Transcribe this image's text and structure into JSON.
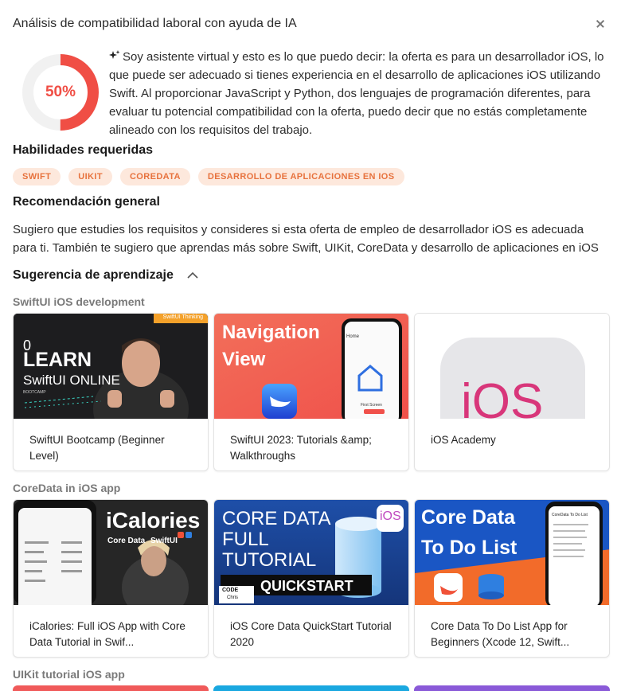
{
  "modal": {
    "title": "Análisis de compatibilidad laboral con ayuda de IA"
  },
  "score": {
    "percent": 50,
    "label": "50%",
    "color": "#f04e45"
  },
  "summary": "Soy asistente virtual y esto es lo que puedo decir: la oferta es para un desarrollador iOS, lo que puede ser adecuado si tienes experiencia en el desarrollo de aplicaciones iOS utilizando Swift. Al proporcionar JavaScript y Python, dos lenguajes de programación diferentes, para evaluar tu potencial compatibilidad con la oferta, puedo decir que no estás completamente alineado con los requisitos del trabajo.",
  "skills": {
    "heading": "Habilidades requeridas",
    "items": [
      "SWIFT",
      "UIKIT",
      "COREDATA",
      "DESARROLLO DE APLICACIONES EN IOS"
    ]
  },
  "recommendation": {
    "heading": "Recomendación general",
    "text": "Sugiero que estudies los requisitos y consideres si esta oferta de empleo de desarrollador iOS es adecuada para ti. También te sugiero que aprendas más sobre Swift, UIKit, CoreData y desarrollo de aplicaciones en iOS"
  },
  "learning": {
    "heading": "Sugerencia de aprendizaje",
    "categories": [
      {
        "name": "SwiftUI iOS development",
        "cards": [
          {
            "title": "SwiftUI Bootcamp (Beginner Level)",
            "thumb_text": [
              "0",
              "LEARN",
              "SwiftUI ONLINE",
              "BOOTCAMP",
              "SwiftUI Thinking"
            ]
          },
          {
            "title": "SwiftUI 2023: Tutorials &amp; Walkthroughs",
            "thumb_text": [
              "Navigation",
              "View",
              "Home",
              "First Screen"
            ]
          },
          {
            "title": "iOS Academy",
            "thumb_text": [
              "iOS"
            ]
          }
        ]
      },
      {
        "name": "CoreData in iOS app",
        "cards": [
          {
            "title": "iCalories: Full iOS App with Core Data Tutorial in Swif...",
            "thumb_text": [
              "iCalories",
              "Core Data",
              "SwiftUI"
            ]
          },
          {
            "title": "iOS Core Data QuickStart Tutorial 2020",
            "thumb_text": [
              "CORE DATA",
              "FULL",
              "TUTORIAL",
              "QUICKSTART",
              "iOS",
              "CODE",
              "Chris"
            ]
          },
          {
            "title": "Core Data To Do List App for Beginners (Xcode 12, Swift...",
            "thumb_text": [
              "Core Data",
              "To Do List",
              "CoreData To Do List"
            ]
          }
        ]
      },
      {
        "name": "UIKit tutorial iOS app",
        "cards": []
      }
    ]
  }
}
